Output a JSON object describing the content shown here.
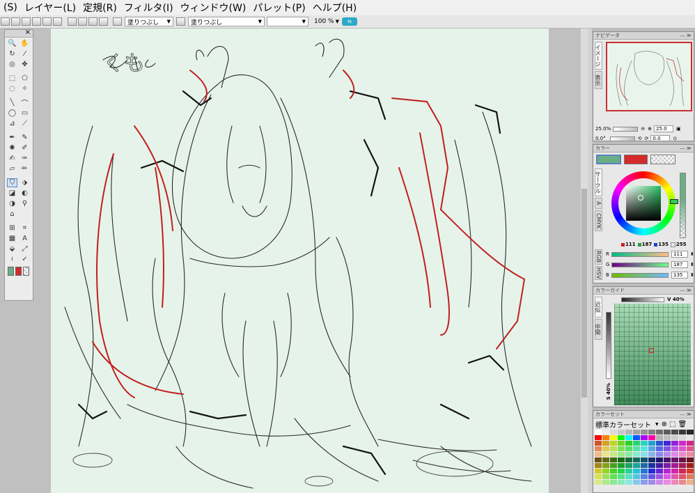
{
  "menu": [
    "(S)",
    "レイヤー(L)",
    "定規(R)",
    "フィルタ(I)",
    "ウィンドウ(W)",
    "パレット(P)",
    "ヘルプ(H)"
  ],
  "toolbar": {
    "brush1": "塗りつぶし",
    "brush2": "塗りつぶし",
    "zoom": "100 %"
  },
  "canvas": {
    "annotation": "くも"
  },
  "navigator": {
    "title": "ナビゲータ",
    "tabs": [
      "イメージ",
      "表示"
    ],
    "zoom_pct": "25.0%",
    "zoom_value": "25.0",
    "angle_label": "0.0°",
    "angle_value": "0.0"
  },
  "color": {
    "title": "カラー",
    "main": "#6aae84",
    "sub": "#d42a2a",
    "tabs": [
      "サークル",
      "A",
      "CMYK",
      "RGB",
      "HSV"
    ],
    "r": 111,
    "g": 187,
    "b": 135,
    "alpha": 255,
    "readout_r": "111",
    "readout_g": "187",
    "readout_b": "135",
    "readout_a": "255"
  },
  "guide": {
    "title": "カラーガイド",
    "tabs": [
      "近似",
      "中間"
    ],
    "v_label": "V 40%",
    "s_label": "S 40%"
  },
  "colorset": {
    "title": "カラーセット",
    "name": "標準カラーセット"
  }
}
